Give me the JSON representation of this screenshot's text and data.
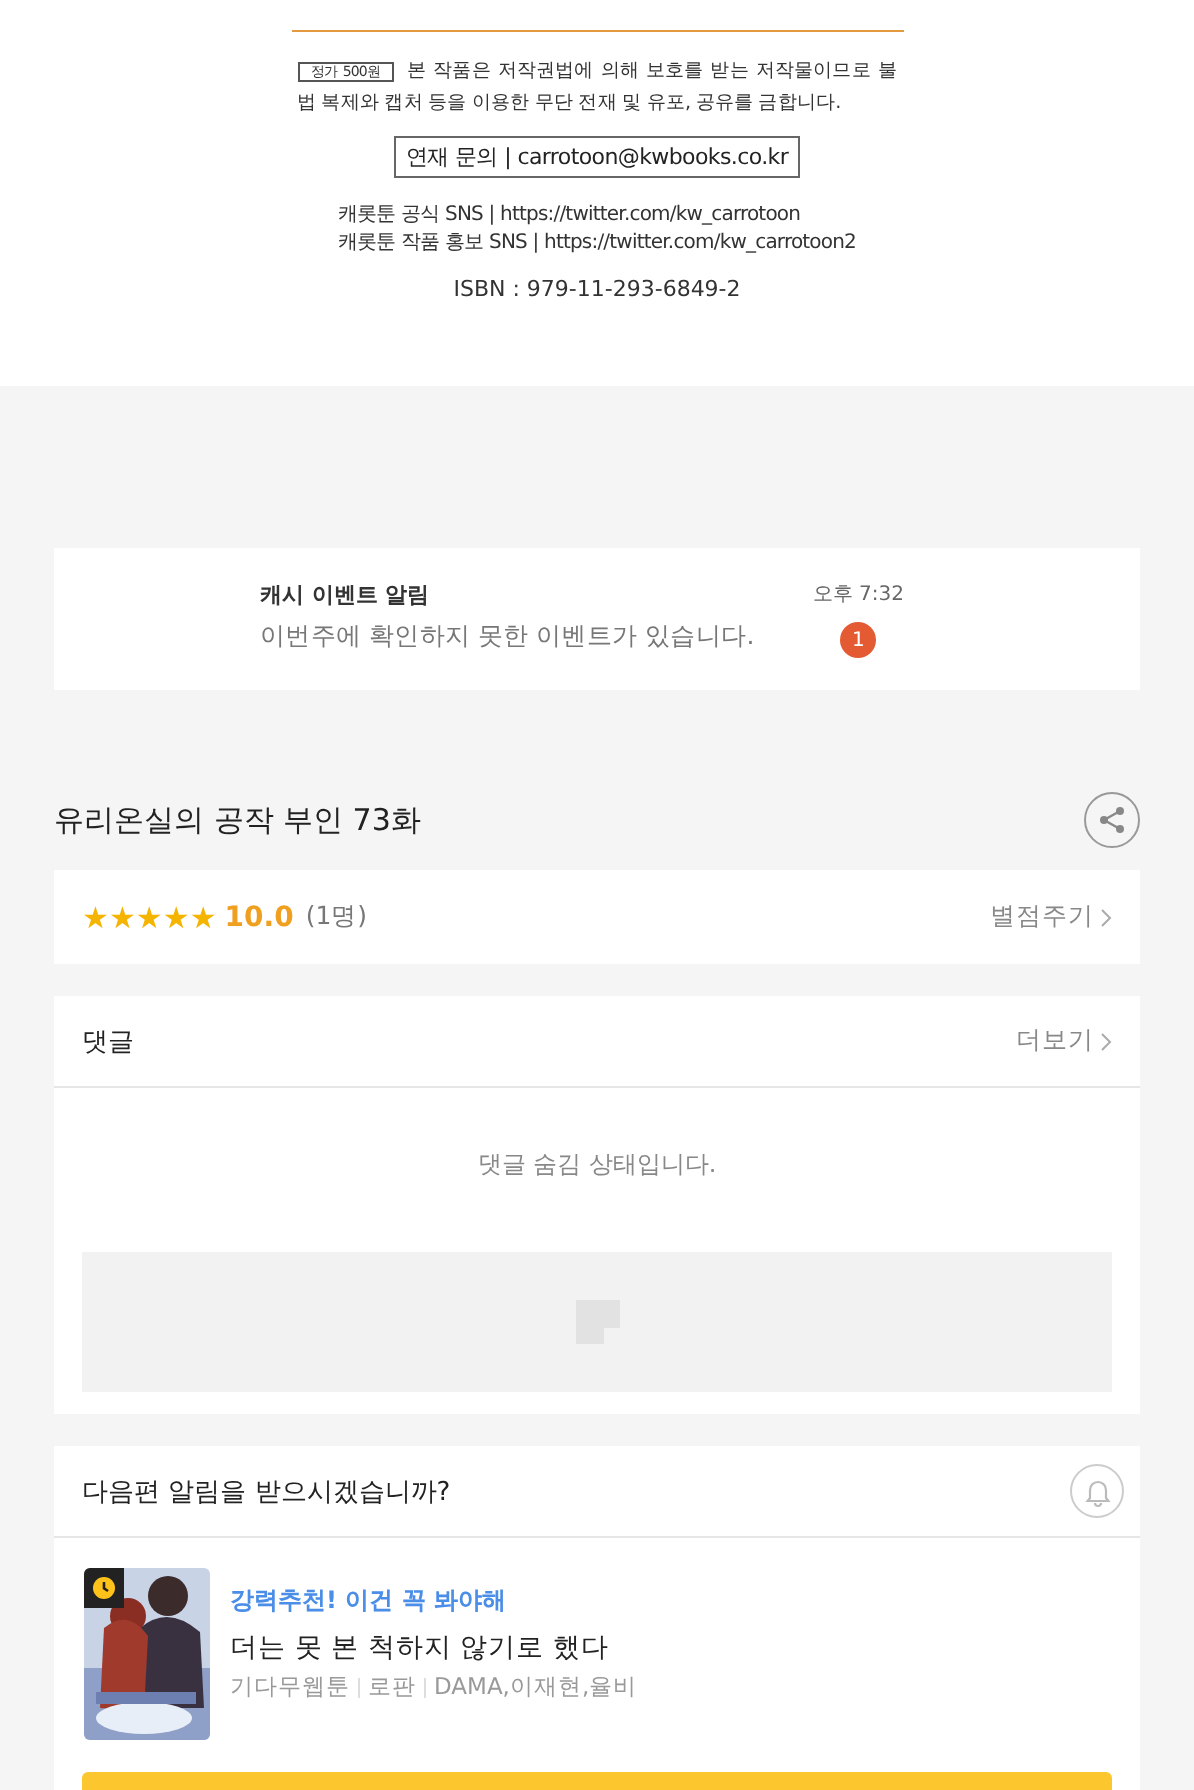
{
  "copyright_page": {
    "price_tag": "정가 500원",
    "notice": "본 작품은 저작권법에 의해 보호를 받는 저작물이므로 불법 복제와 캡처 등을 이용한 무단 전재 및 유포, 공유를 금합니다.",
    "contact": "연재 문의 | carrotoon@kwbooks.co.kr",
    "sns_lines": [
      "캐롯툰 공식 SNS | https://twitter.com/kw_carrotoon",
      "캐롯툰 작품 홍보 SNS | https://twitter.com/kw_carrotoon2"
    ],
    "isbn": "ISBN : 979-11-293-6849-2"
  },
  "notification": {
    "title": "캐시 이벤트 알림",
    "message": "이번주에 확인하지 못한 이벤트가 있습니다.",
    "time": "오후 7:32",
    "badge": "1"
  },
  "episode": {
    "title": "유리온실의 공작 부인 73화"
  },
  "rating": {
    "stars": 5,
    "score": "10.0",
    "count": "(1명)",
    "action": "별점주기"
  },
  "comments": {
    "title": "댓글",
    "more": "더보기",
    "empty_message": "댓글 숨김 상태입니다."
  },
  "next_episode": {
    "question": "다음편 알림을 받으시겠습니까?",
    "notify_on": false
  },
  "recommendation": {
    "tag": "강력추천! 이건 꼭 봐야해",
    "title": "더는 못 본 척하지 않기로 했다",
    "meta": [
      "기다무웹툰",
      "로판",
      "DAMA,이재현,율비"
    ],
    "wait_free": true
  }
}
